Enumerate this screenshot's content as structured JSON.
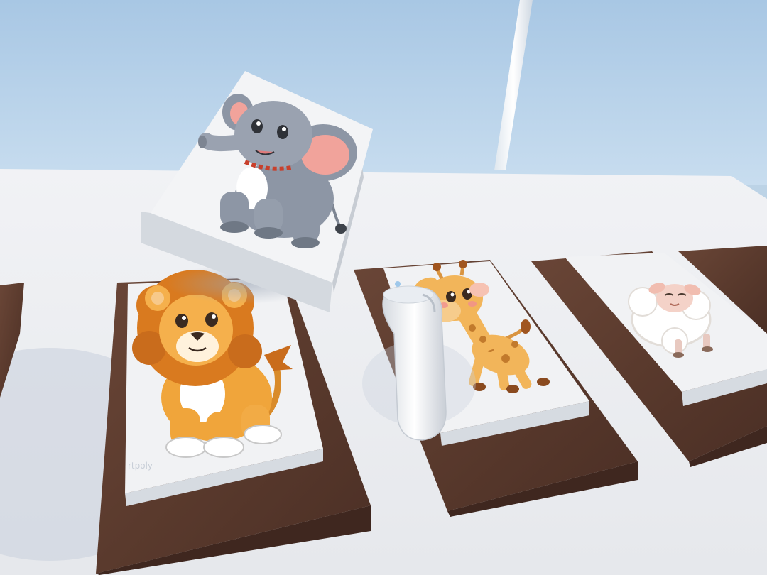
{
  "scene": {
    "type": "VR memory matching game",
    "colors": {
      "sky_top": "#a9c8e4",
      "sky_bottom": "#c6dcee",
      "table": "#eef0f4",
      "tray_wood": "#5e3b2e",
      "card_face": "#f3f4f6",
      "card_side": "#d9dde2"
    },
    "cards": [
      {
        "animal": "elephant",
        "state": "held-lifted"
      },
      {
        "animal": "lion",
        "state": "face-up"
      },
      {
        "animal": "giraffe",
        "state": "face-up"
      },
      {
        "animal": "sheep",
        "state": "face-up"
      }
    ],
    "controller": {
      "type": "vr-controller",
      "color": "#f2f4f6"
    }
  },
  "watermark": {
    "text": "rtpoly"
  }
}
